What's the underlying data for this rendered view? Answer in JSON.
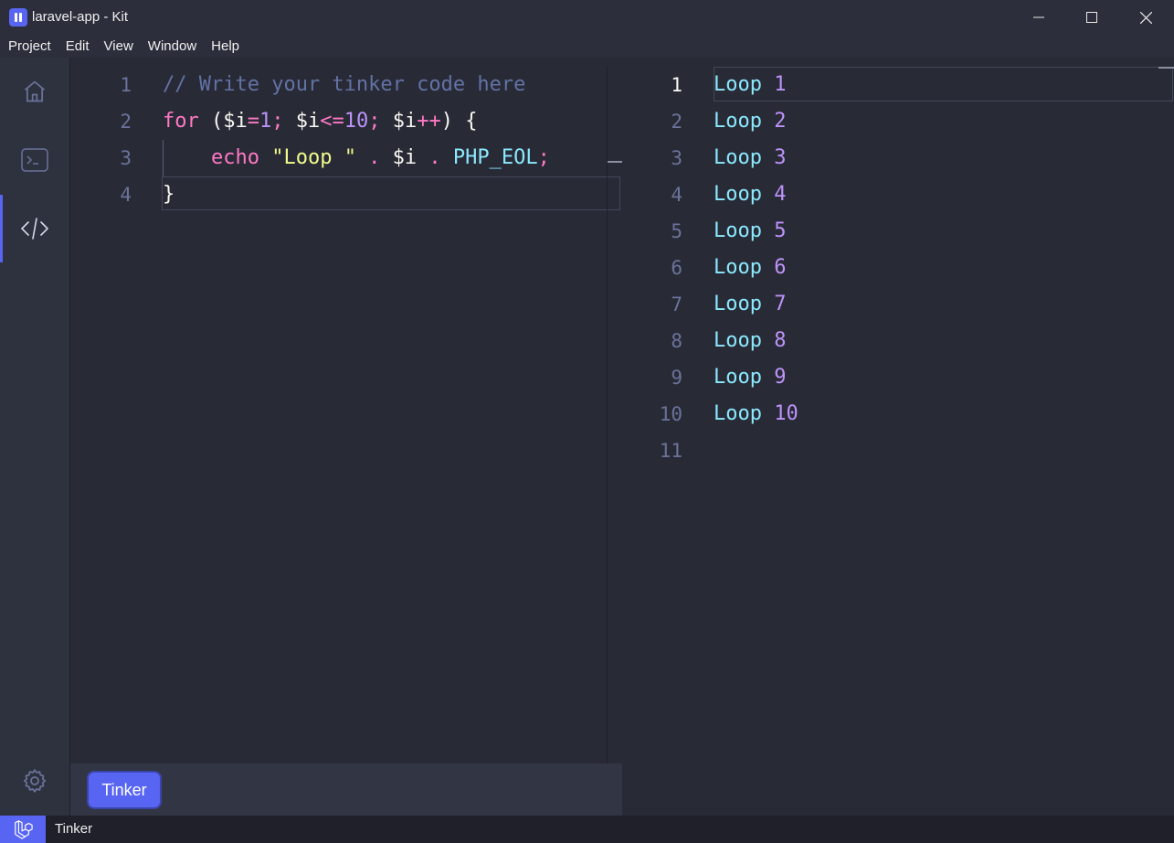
{
  "window": {
    "title": "laravel-app - Kit"
  },
  "menu": [
    "Project",
    "Edit",
    "View",
    "Window",
    "Help"
  ],
  "sidebar": {
    "items": [
      {
        "name": "home",
        "icon": "home-icon"
      },
      {
        "name": "terminal",
        "icon": "terminal-icon"
      },
      {
        "name": "code",
        "icon": "code-icon",
        "active": true
      }
    ],
    "settings_icon": "gear-icon"
  },
  "editor": {
    "line_numbers": [
      "1",
      "2",
      "3",
      "4"
    ],
    "lines": [
      [
        {
          "t": "// Write your tinker code here",
          "c": "comment"
        }
      ],
      [
        {
          "t": "for",
          "c": "key"
        },
        {
          "t": " ($i",
          "c": "fg"
        },
        {
          "t": "=",
          "c": "key"
        },
        {
          "t": "1",
          "c": "num"
        },
        {
          "t": ";",
          "c": "key"
        },
        {
          "t": " $i",
          "c": "fg"
        },
        {
          "t": "<=",
          "c": "key"
        },
        {
          "t": "10",
          "c": "num"
        },
        {
          "t": ";",
          "c": "key"
        },
        {
          "t": " $i",
          "c": "fg"
        },
        {
          "t": "++",
          "c": "key"
        },
        {
          "t": ") {",
          "c": "fg"
        }
      ],
      [
        {
          "t": "    ",
          "c": "fg"
        },
        {
          "t": "echo",
          "c": "key"
        },
        {
          "t": " ",
          "c": "fg"
        },
        {
          "t": "\"Loop \"",
          "c": "str"
        },
        {
          "t": " .",
          "c": "key"
        },
        {
          "t": " $i",
          "c": "fg"
        },
        {
          "t": " .",
          "c": "key"
        },
        {
          "t": " PHP_EOL",
          "c": "const"
        },
        {
          "t": ";",
          "c": "key"
        }
      ],
      [
        {
          "t": "}",
          "c": "fg"
        }
      ]
    ]
  },
  "tinker_button": {
    "label": "Tinker"
  },
  "output": {
    "line_numbers": [
      "1",
      "2",
      "3",
      "4",
      "5",
      "6",
      "7",
      "8",
      "9",
      "10",
      "11"
    ],
    "lines": [
      {
        "word": "Loop",
        "num": "1"
      },
      {
        "word": "Loop",
        "num": "2"
      },
      {
        "word": "Loop",
        "num": "3"
      },
      {
        "word": "Loop",
        "num": "4"
      },
      {
        "word": "Loop",
        "num": "5"
      },
      {
        "word": "Loop",
        "num": "6"
      },
      {
        "word": "Loop",
        "num": "7"
      },
      {
        "word": "Loop",
        "num": "8"
      },
      {
        "word": "Loop",
        "num": "9"
      },
      {
        "word": "Loop",
        "num": "10"
      },
      {
        "word": "",
        "num": ""
      }
    ]
  },
  "status": {
    "text": "Tinker",
    "icon": "laravel-icon"
  },
  "colors": {
    "accent": "#5865f2",
    "background": "#282a36",
    "keyword": "#ff79c6",
    "number": "#bd93f9",
    "string": "#f1fa8c",
    "constant": "#8be9fd",
    "comment": "#6272a4"
  }
}
